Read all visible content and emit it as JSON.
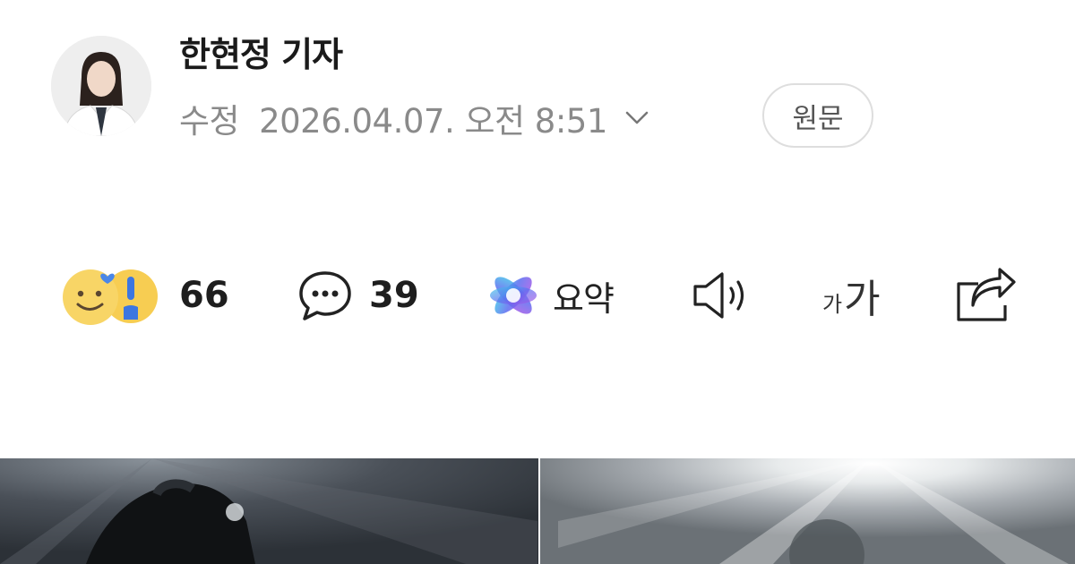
{
  "author": {
    "name": "한현정 기자",
    "avatar_icon": "reporter-avatar"
  },
  "meta": {
    "edit_label": "수정",
    "datetime": "2026.04.07. 오전 8:51",
    "expand_icon": "chevron-down-icon",
    "original_button": "원문"
  },
  "actions": {
    "reaction": {
      "icon": "reaction-emoji-icon",
      "count": "66"
    },
    "comment": {
      "icon": "comment-bubble-icon",
      "count": "39"
    },
    "summary": {
      "icon": "ai-summary-icon",
      "label": "요약"
    },
    "listen": {
      "icon": "speaker-icon"
    },
    "font_size": {
      "small": "가",
      "big": "가"
    },
    "share": {
      "icon": "share-icon"
    }
  },
  "photos": [
    {
      "name": "concert-photo-left",
      "tone": "#363c44"
    },
    {
      "name": "concert-photo-right",
      "tone": "#a9adb2"
    }
  ]
}
